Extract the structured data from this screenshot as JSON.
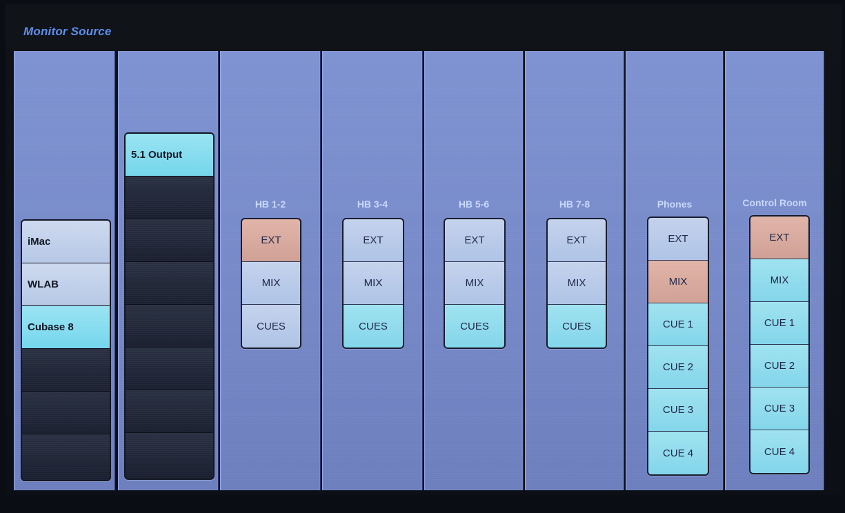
{
  "page": {
    "title": "Monitor Source"
  },
  "sources": {
    "computers": [
      "iMac",
      "WLAB",
      "Cubase 8"
    ],
    "selected_computer": "Cubase 8",
    "outputs": [
      "5.1 Output"
    ],
    "selected_output": "5.1 Output"
  },
  "groups": [
    {
      "label": "HB 1-2",
      "buttons": [
        "EXT",
        "MIX",
        "CUES"
      ],
      "active": "EXT"
    },
    {
      "label": "HB 3-4",
      "buttons": [
        "EXT",
        "MIX",
        "CUES"
      ],
      "active": null
    },
    {
      "label": "HB 5-6",
      "buttons": [
        "EXT",
        "MIX",
        "CUES"
      ],
      "active": null
    },
    {
      "label": "HB 7-8",
      "buttons": [
        "EXT",
        "MIX",
        "CUES"
      ],
      "active": null
    },
    {
      "label": "Phones",
      "buttons": [
        "EXT",
        "MIX",
        "CUE 1",
        "CUE 2",
        "CUE 3",
        "CUE 4"
      ],
      "active": "MIX"
    },
    {
      "label": "Control Room",
      "buttons": [
        "EXT",
        "MIX",
        "CUE 1",
        "CUE 2",
        "CUE 3",
        "CUE 4"
      ],
      "active": "EXT"
    }
  ],
  "colors": {
    "active": "#d9aa9e",
    "selected": "#86d9ee",
    "title": "#5d8ff0"
  }
}
